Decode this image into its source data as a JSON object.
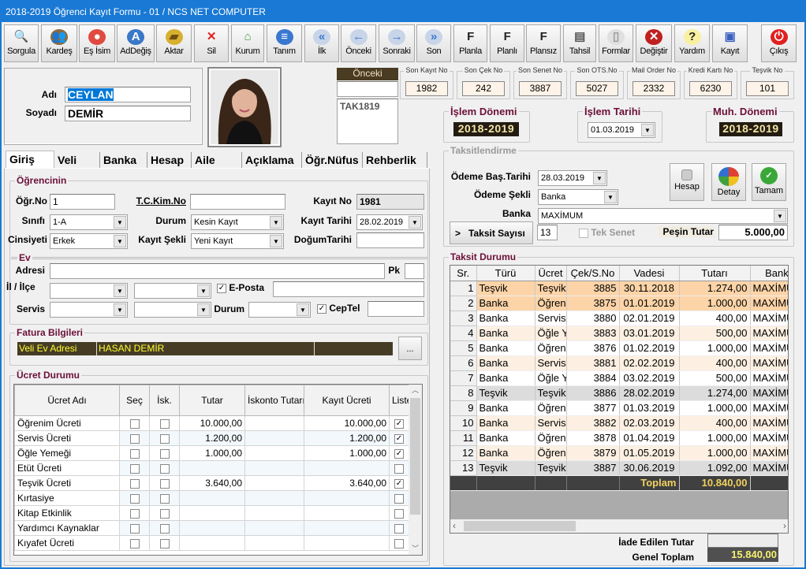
{
  "window": {
    "title": "2018-2019 Öğrenci Kayıt Formu - 01 / NCS NET COMPUTER",
    "accent": "#1979d4"
  },
  "toolbar": [
    {
      "label": "Sorgula",
      "icon": "search-icon"
    },
    {
      "label": "Kardeş",
      "icon": "siblings-icon"
    },
    {
      "label": "Eş İsim",
      "icon": "group-icon"
    },
    {
      "label": "AdDeğiş",
      "icon": "rename-icon"
    },
    {
      "label": "Aktar",
      "icon": "folder-open-icon"
    },
    {
      "label": "Sil",
      "icon": "delete-icon"
    },
    {
      "label": "Kurum",
      "icon": "house-icon"
    },
    {
      "label": "Tanım",
      "icon": "document-icon"
    },
    {
      "label": "İlk",
      "icon": "first-icon"
    },
    {
      "label": "Önceki",
      "icon": "previous-icon"
    },
    {
      "label": "Sonraki",
      "icon": "next-icon"
    },
    {
      "label": "Son",
      "icon": "last-icon"
    },
    {
      "label": "Planla",
      "icon": "plan-add-icon"
    },
    {
      "label": "Planlı",
      "icon": "plan-add-icon"
    },
    {
      "label": "Plansız",
      "icon": "plan-add-icon"
    },
    {
      "label": "Tahsil",
      "icon": "cash-register-icon"
    },
    {
      "label": "Formlar",
      "icon": "forms-icon"
    },
    {
      "label": "Değiştir",
      "icon": "edit-icon"
    },
    {
      "label": "Yardım",
      "icon": "help-icon"
    },
    {
      "label": "Kayıt",
      "icon": "save-icon"
    },
    {
      "label": "Çıkış",
      "icon": "power-icon"
    }
  ],
  "person": {
    "ad_label": "Adı",
    "ad": "CEYLAN",
    "soyad_label": "Soyadı",
    "soyad": "DEMİR"
  },
  "onceki": {
    "label": "Önceki Dönem",
    "value": "",
    "list": "TAK1819"
  },
  "stats": [
    {
      "label": "Son Kayıt No",
      "value": "1982"
    },
    {
      "label": "Son Çek No",
      "value": "242"
    },
    {
      "label": "Son Senet No",
      "value": "3887"
    },
    {
      "label": "Son OTS.No",
      "value": "5027"
    },
    {
      "label": "Mail Order No",
      "value": "2332"
    },
    {
      "label": "Kredi Kartı No",
      "value": "6230"
    },
    {
      "label": "Teşvik No",
      "value": "101"
    }
  ],
  "period": {
    "islem_donemi_label": "İşlem Dönemi",
    "islem_donemi": "2018-2019",
    "islem_tarihi_label": "İşlem Tarihi",
    "islem_tarihi": "01.03.2019",
    "muh_label": "Muh. Dönemi",
    "muh": "2018-2019"
  },
  "tabs": [
    "Giriş",
    "Veli",
    "Banka",
    "Hesap",
    "Aile",
    "Açıklama",
    "Öğr.Nüfus",
    "Rehberlik"
  ],
  "ogrenci": {
    "group": "Öğrencinin",
    "ogrno_label": "Öğr.No",
    "ogrno": "1",
    "tc_label": "T.C.Kim.No",
    "tc": "",
    "kayitno_label": "Kayıt No",
    "kayitno": "1981",
    "sinif_label": "Sınıfı",
    "sinif": "1-A",
    "durum_label": "Durum",
    "durum": "Kesin Kayıt",
    "kayittarihi_label": "Kayıt Tarihi",
    "kayittarihi": "28.02.2019",
    "cinsiyet_label": "Cinsiyeti",
    "cinsiyet": "Erkek",
    "kayitsekli_label": "Kayıt Şekli",
    "kayitsekli": "Yeni Kayıt",
    "dogum_label": "DoğumTarihi",
    "dogum": ""
  },
  "ev": {
    "group": "Ev",
    "adres_label": "Adresi",
    "pk_label": "Pk",
    "il_label": "İl / İlçe",
    "eposta_label": "E-Posta",
    "servis_label": "Servis",
    "durum_label": "Durum",
    "ceptel_label": "CepTel"
  },
  "fatura": {
    "group": "Fatura Bilgileri",
    "type": "Veli Ev Adresi",
    "name": "HASAN DEMİR",
    "more": "..."
  },
  "ucret": {
    "group": "Ücret Durumu",
    "headers": [
      "Ücret Adı",
      "Seç",
      "İsk.",
      "Tutar",
      "İskonto Tutarı",
      "Kayıt Ücreti",
      "Liste"
    ],
    "rows": [
      {
        "name": "Öğrenim Ücreti",
        "sec": false,
        "isk": false,
        "tutar": "10.000,00",
        "iskonto": "",
        "kayit": "10.000,00",
        "liste": true
      },
      {
        "name": "Servis Ücreti",
        "sec": false,
        "isk": false,
        "tutar": "1.200,00",
        "iskonto": "",
        "kayit": "1.200,00",
        "liste": true
      },
      {
        "name": "Öğle Yemeği",
        "sec": false,
        "isk": false,
        "tutar": "1.000,00",
        "iskonto": "",
        "kayit": "1.000,00",
        "liste": true
      },
      {
        "name": "Etüt Ücreti",
        "sec": false,
        "isk": false,
        "tutar": "",
        "iskonto": "",
        "kayit": "",
        "liste": false
      },
      {
        "name": "Teşvik Ücreti",
        "sec": false,
        "isk": false,
        "tutar": "3.640,00",
        "iskonto": "",
        "kayit": "3.640,00",
        "liste": true
      },
      {
        "name": "Kırtasiye",
        "sec": false,
        "isk": false,
        "tutar": "",
        "iskonto": "",
        "kayit": "",
        "liste": false
      },
      {
        "name": "Kitap Etkinlik",
        "sec": false,
        "isk": false,
        "tutar": "",
        "iskonto": "",
        "kayit": "",
        "liste": false
      },
      {
        "name": "Yardımcı Kaynaklar",
        "sec": false,
        "isk": false,
        "tutar": "",
        "iskonto": "",
        "kayit": "",
        "liste": false
      },
      {
        "name": "Kıyafet Ücreti",
        "sec": false,
        "isk": false,
        "tutar": "",
        "iskonto": "",
        "kayit": "",
        "liste": false
      }
    ]
  },
  "taksitlendirme": {
    "group": "Taksitlendirme",
    "bas_label": "Ödeme Baş.Tarihi",
    "bas": "28.03.2019",
    "sekil_label": "Ödeme Şekli",
    "sekil": "Banka",
    "banka_label": "Banka",
    "banka": "MAXİMUM",
    "sayi_btn": ">",
    "sayi_label": "Taksit Sayısı",
    "sayi": "13",
    "tek_senet": "Tek Senet",
    "pesin_label": "Peşin Tutar",
    "pesin": "5.000,00",
    "hesap": "Hesap",
    "detay": "Detay",
    "tamam": "Tamam"
  },
  "taksit": {
    "group": "Taksit Durumu",
    "headers": [
      "Sr.",
      "Türü",
      "Ücret",
      "Çek/S.No",
      "Vadesi",
      "Tutarı",
      "Banka"
    ],
    "rows": [
      {
        "sr": "1",
        "tur": "Teşvik",
        "ucret": "Teşvik",
        "no": "3885",
        "vade": "30.11.2018",
        "tutar": "1.274,00",
        "banka": "MAXİMUM",
        "state": "selected"
      },
      {
        "sr": "2",
        "tur": "Banka",
        "ucret": "Öğrenim",
        "no": "3875",
        "vade": "01.01.2019",
        "tutar": "1.000,00",
        "banka": "MAXİMUM",
        "state": "selected"
      },
      {
        "sr": "3",
        "tur": "Banka",
        "ucret": "Servis",
        "no": "3880",
        "vade": "02.01.2019",
        "tutar": "400,00",
        "banka": "MAXİMUM",
        "state": "normal"
      },
      {
        "sr": "4",
        "tur": "Banka",
        "ucret": "Öğle Yemeği",
        "no": "3883",
        "vade": "03.01.2019",
        "tutar": "500,00",
        "banka": "MAXİMUM",
        "state": "alt"
      },
      {
        "sr": "5",
        "tur": "Banka",
        "ucret": "Öğrenim",
        "no": "3876",
        "vade": "01.02.2019",
        "tutar": "1.000,00",
        "banka": "MAXİMUM",
        "state": "normal"
      },
      {
        "sr": "6",
        "tur": "Banka",
        "ucret": "Servis",
        "no": "3881",
        "vade": "02.02.2019",
        "tutar": "400,00",
        "banka": "MAXİMUM",
        "state": "alt"
      },
      {
        "sr": "7",
        "tur": "Banka",
        "ucret": "Öğle Yemeği",
        "no": "3884",
        "vade": "03.02.2019",
        "tutar": "500,00",
        "banka": "MAXİMUM",
        "state": "normal"
      },
      {
        "sr": "8",
        "tur": "Teşvik",
        "ucret": "Teşvik",
        "no": "3886",
        "vade": "28.02.2019",
        "tutar": "1.274,00",
        "banka": "MAXİMUM",
        "state": "gray"
      },
      {
        "sr": "9",
        "tur": "Banka",
        "ucret": "Öğrenim",
        "no": "3877",
        "vade": "01.03.2019",
        "tutar": "1.000,00",
        "banka": "MAXİMUM",
        "state": "normal"
      },
      {
        "sr": "10",
        "tur": "Banka",
        "ucret": "Servis",
        "no": "3882",
        "vade": "02.03.2019",
        "tutar": "400,00",
        "banka": "MAXİMUM",
        "state": "alt"
      },
      {
        "sr": "11",
        "tur": "Banka",
        "ucret": "Öğrenim",
        "no": "3878",
        "vade": "01.04.2019",
        "tutar": "1.000,00",
        "banka": "MAXİMUM",
        "state": "normal"
      },
      {
        "sr": "12",
        "tur": "Banka",
        "ucret": "Öğrenim",
        "no": "3879",
        "vade": "01.05.2019",
        "tutar": "1.000,00",
        "banka": "MAXİMUM",
        "state": "alt"
      },
      {
        "sr": "13",
        "tur": "Teşvik",
        "ucret": "Teşvik",
        "no": "3887",
        "vade": "30.06.2019",
        "tutar": "1.092,00",
        "banka": "MAXİMUM",
        "state": "gray"
      }
    ],
    "toplam_label": "Toplam",
    "toplam": "10.840,00",
    "iade_label": "İade Edilen Tutar",
    "iade": "",
    "genel_label": "Genel Toplam",
    "genel": "15.840,00"
  }
}
